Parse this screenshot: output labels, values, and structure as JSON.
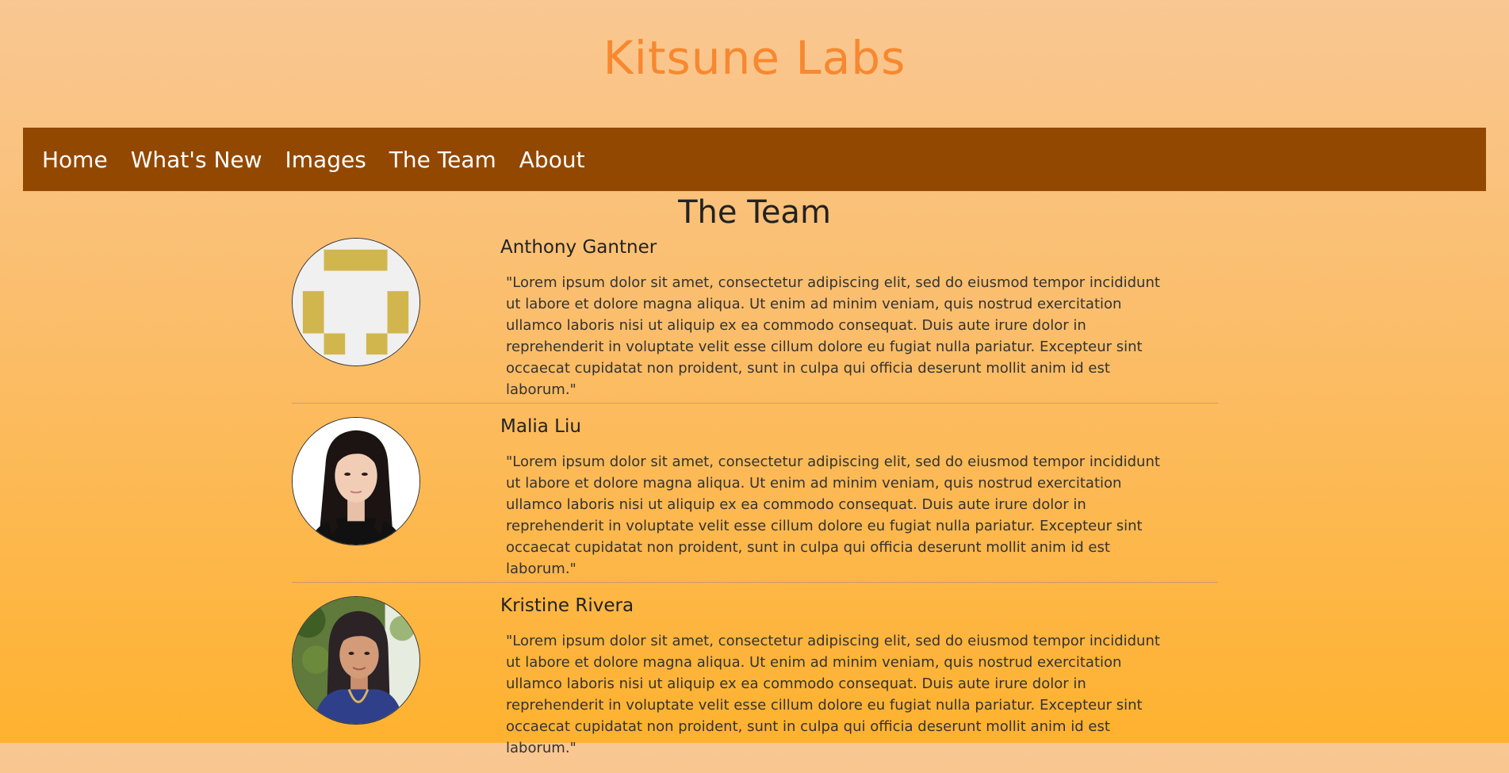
{
  "site": {
    "title": "Kitsune Labs",
    "title_color": "#f7882f"
  },
  "nav": {
    "background": "#934800",
    "items": [
      {
        "label": "Home"
      },
      {
        "label": "What's New"
      },
      {
        "label": "Images"
      },
      {
        "label": "The Team"
      },
      {
        "label": "About"
      }
    ]
  },
  "page": {
    "section_title": "The Team"
  },
  "team": [
    {
      "name": "Anthony Gantner",
      "avatar": "identicon-avatar",
      "quote": "\"Lorem ipsum dolor sit amet, consectetur adipiscing elit, sed do eiusmod tempor incididunt ut labore et dolore magna aliqua. Ut enim ad minim veniam, quis nostrud exercitation ullamco laboris nisi ut aliquip ex ea commodo consequat. Duis aute irure dolor in reprehenderit in voluptate velit esse cillum dolore eu fugiat nulla pariatur. Excepteur sint occaecat cupidatat non proident, sunt in culpa qui officia deserunt mollit anim id est laborum.\""
    },
    {
      "name": "Malia Liu",
      "avatar": "person-photo",
      "quote": "\"Lorem ipsum dolor sit amet, consectetur adipiscing elit, sed do eiusmod tempor incididunt ut labore et dolore magna aliqua. Ut enim ad minim veniam, quis nostrud exercitation ullamco laboris nisi ut aliquip ex ea commodo consequat. Duis aute irure dolor in reprehenderit in voluptate velit esse cillum dolore eu fugiat nulla pariatur. Excepteur sint occaecat cupidatat non proident, sunt in culpa qui officia deserunt mollit anim id est laborum.\""
    },
    {
      "name": "Kristine Rivera",
      "avatar": "person-photo",
      "quote": "\"Lorem ipsum dolor sit amet, consectetur adipiscing elit, sed do eiusmod tempor incididunt ut labore et dolore magna aliqua. Ut enim ad minim veniam, quis nostrud exercitation ullamco laboris nisi ut aliquip ex ea commodo consequat. Duis aute irure dolor in reprehenderit in voluptate velit esse cillum dolore eu fugiat nulla pariatur. Excepteur sint occaecat cupidatat non proident, sunt in culpa qui officia deserunt mollit anim id est laborum.\""
    }
  ]
}
